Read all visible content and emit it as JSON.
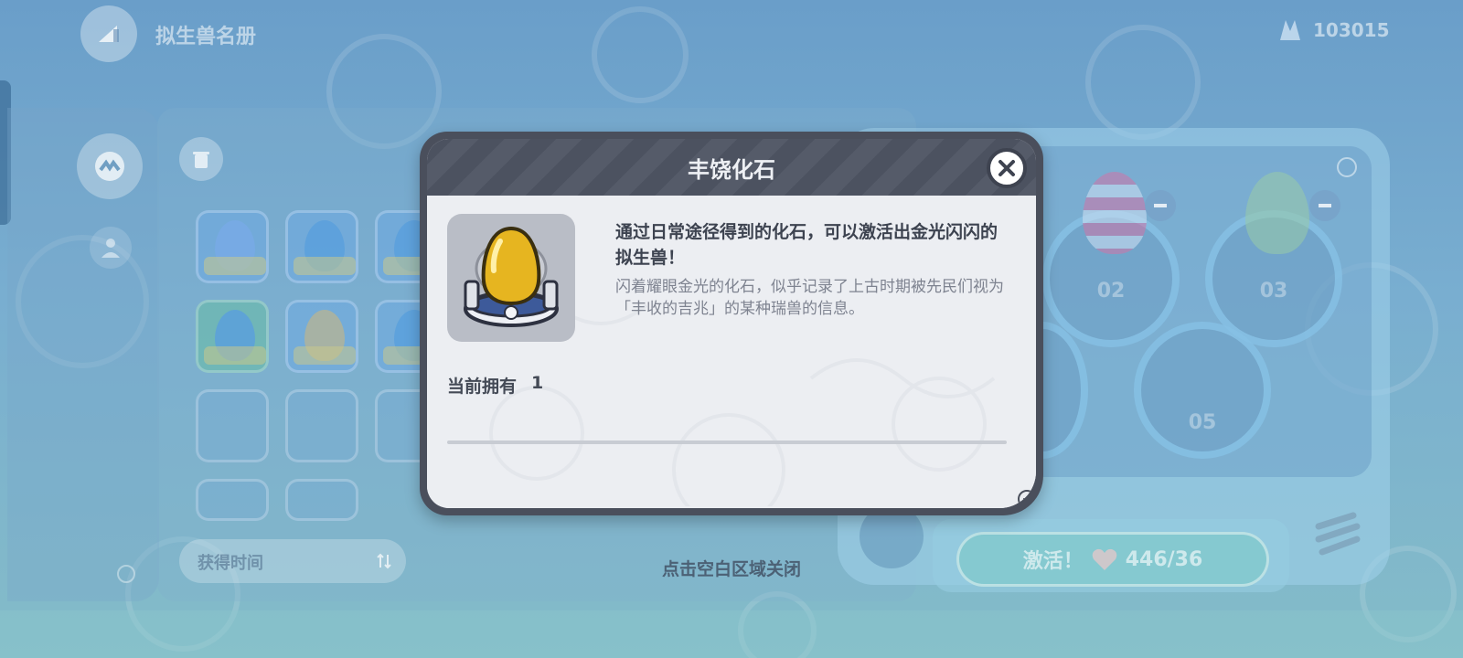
{
  "header": {
    "title": "拟生兽名册",
    "currency_value": "103015"
  },
  "sort": {
    "label": "获得时间"
  },
  "slots_right": [
    {
      "number": "02"
    },
    {
      "number": "03"
    },
    {
      "number": "05"
    }
  ],
  "activate": {
    "label": "激活！",
    "count": "446/36"
  },
  "close_hint": "点击空白区域关闭",
  "modal": {
    "title": "丰饶化石",
    "description_main": "通过日常途径得到的化石，可以激活出金光闪闪的拟生兽！",
    "description_sub": "闪着耀眼金光的化石，似乎记录了上古时期被先民们视为「丰收的吉兆」的某种瑞兽的信息。",
    "owned_label": "当前拥有",
    "owned_count": "1"
  },
  "colors": {
    "modal_frame": "#4a4f5c",
    "modal_bg": "#eceef2",
    "egg_gold": "#e6b520",
    "accent_blue": "#6a9ec9"
  },
  "icons": {
    "back": "back-arrow-icon",
    "currency": "crystal-icon",
    "trash": "trash-icon",
    "close": "close-icon",
    "heart": "heart-icon"
  }
}
